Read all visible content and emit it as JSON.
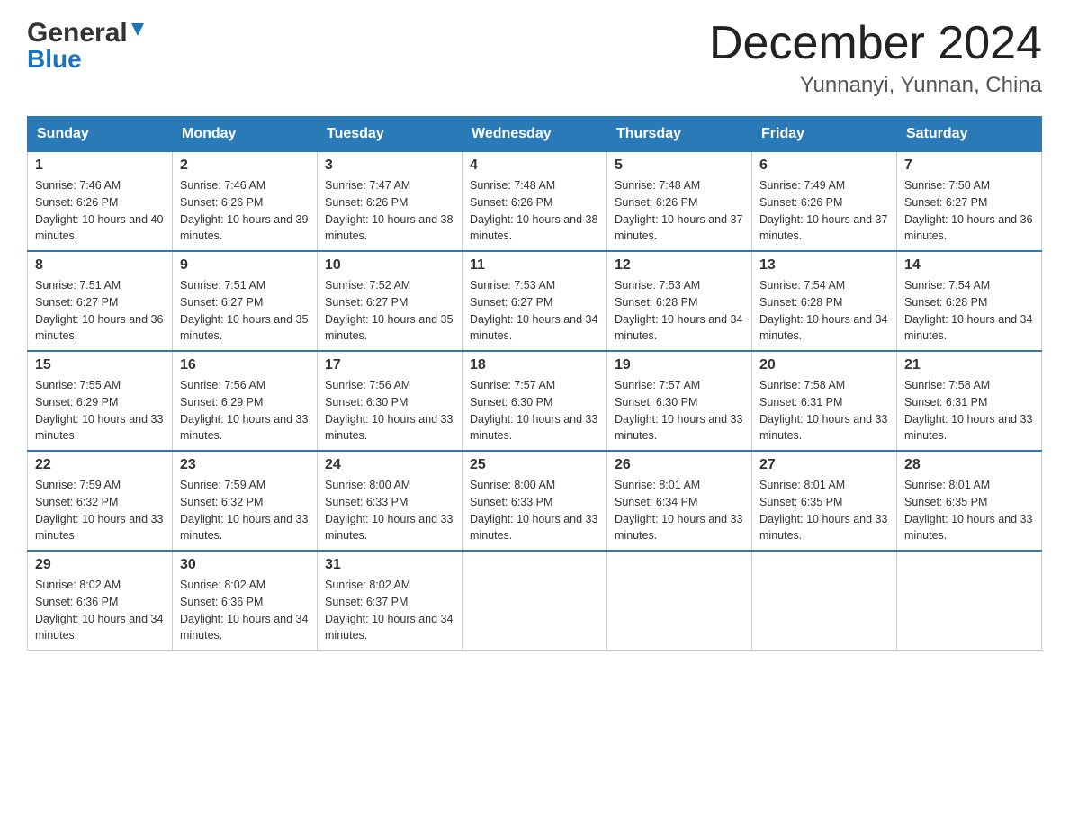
{
  "header": {
    "logo": {
      "general": "General",
      "blue": "Blue"
    },
    "title": "December 2024",
    "location": "Yunnanyi, Yunnan, China"
  },
  "calendar": {
    "headers": [
      "Sunday",
      "Monday",
      "Tuesday",
      "Wednesday",
      "Thursday",
      "Friday",
      "Saturday"
    ],
    "weeks": [
      [
        {
          "day": "1",
          "sunrise": "7:46 AM",
          "sunset": "6:26 PM",
          "daylight": "10 hours and 40 minutes."
        },
        {
          "day": "2",
          "sunrise": "7:46 AM",
          "sunset": "6:26 PM",
          "daylight": "10 hours and 39 minutes."
        },
        {
          "day": "3",
          "sunrise": "7:47 AM",
          "sunset": "6:26 PM",
          "daylight": "10 hours and 38 minutes."
        },
        {
          "day": "4",
          "sunrise": "7:48 AM",
          "sunset": "6:26 PM",
          "daylight": "10 hours and 38 minutes."
        },
        {
          "day": "5",
          "sunrise": "7:48 AM",
          "sunset": "6:26 PM",
          "daylight": "10 hours and 37 minutes."
        },
        {
          "day": "6",
          "sunrise": "7:49 AM",
          "sunset": "6:26 PM",
          "daylight": "10 hours and 37 minutes."
        },
        {
          "day": "7",
          "sunrise": "7:50 AM",
          "sunset": "6:27 PM",
          "daylight": "10 hours and 36 minutes."
        }
      ],
      [
        {
          "day": "8",
          "sunrise": "7:51 AM",
          "sunset": "6:27 PM",
          "daylight": "10 hours and 36 minutes."
        },
        {
          "day": "9",
          "sunrise": "7:51 AM",
          "sunset": "6:27 PM",
          "daylight": "10 hours and 35 minutes."
        },
        {
          "day": "10",
          "sunrise": "7:52 AM",
          "sunset": "6:27 PM",
          "daylight": "10 hours and 35 minutes."
        },
        {
          "day": "11",
          "sunrise": "7:53 AM",
          "sunset": "6:27 PM",
          "daylight": "10 hours and 34 minutes."
        },
        {
          "day": "12",
          "sunrise": "7:53 AM",
          "sunset": "6:28 PM",
          "daylight": "10 hours and 34 minutes."
        },
        {
          "day": "13",
          "sunrise": "7:54 AM",
          "sunset": "6:28 PM",
          "daylight": "10 hours and 34 minutes."
        },
        {
          "day": "14",
          "sunrise": "7:54 AM",
          "sunset": "6:28 PM",
          "daylight": "10 hours and 34 minutes."
        }
      ],
      [
        {
          "day": "15",
          "sunrise": "7:55 AM",
          "sunset": "6:29 PM",
          "daylight": "10 hours and 33 minutes."
        },
        {
          "day": "16",
          "sunrise": "7:56 AM",
          "sunset": "6:29 PM",
          "daylight": "10 hours and 33 minutes."
        },
        {
          "day": "17",
          "sunrise": "7:56 AM",
          "sunset": "6:30 PM",
          "daylight": "10 hours and 33 minutes."
        },
        {
          "day": "18",
          "sunrise": "7:57 AM",
          "sunset": "6:30 PM",
          "daylight": "10 hours and 33 minutes."
        },
        {
          "day": "19",
          "sunrise": "7:57 AM",
          "sunset": "6:30 PM",
          "daylight": "10 hours and 33 minutes."
        },
        {
          "day": "20",
          "sunrise": "7:58 AM",
          "sunset": "6:31 PM",
          "daylight": "10 hours and 33 minutes."
        },
        {
          "day": "21",
          "sunrise": "7:58 AM",
          "sunset": "6:31 PM",
          "daylight": "10 hours and 33 minutes."
        }
      ],
      [
        {
          "day": "22",
          "sunrise": "7:59 AM",
          "sunset": "6:32 PM",
          "daylight": "10 hours and 33 minutes."
        },
        {
          "day": "23",
          "sunrise": "7:59 AM",
          "sunset": "6:32 PM",
          "daylight": "10 hours and 33 minutes."
        },
        {
          "day": "24",
          "sunrise": "8:00 AM",
          "sunset": "6:33 PM",
          "daylight": "10 hours and 33 minutes."
        },
        {
          "day": "25",
          "sunrise": "8:00 AM",
          "sunset": "6:33 PM",
          "daylight": "10 hours and 33 minutes."
        },
        {
          "day": "26",
          "sunrise": "8:01 AM",
          "sunset": "6:34 PM",
          "daylight": "10 hours and 33 minutes."
        },
        {
          "day": "27",
          "sunrise": "8:01 AM",
          "sunset": "6:35 PM",
          "daylight": "10 hours and 33 minutes."
        },
        {
          "day": "28",
          "sunrise": "8:01 AM",
          "sunset": "6:35 PM",
          "daylight": "10 hours and 33 minutes."
        }
      ],
      [
        {
          "day": "29",
          "sunrise": "8:02 AM",
          "sunset": "6:36 PM",
          "daylight": "10 hours and 34 minutes."
        },
        {
          "day": "30",
          "sunrise": "8:02 AM",
          "sunset": "6:36 PM",
          "daylight": "10 hours and 34 minutes."
        },
        {
          "day": "31",
          "sunrise": "8:02 AM",
          "sunset": "6:37 PM",
          "daylight": "10 hours and 34 minutes."
        },
        null,
        null,
        null,
        null
      ]
    ]
  }
}
